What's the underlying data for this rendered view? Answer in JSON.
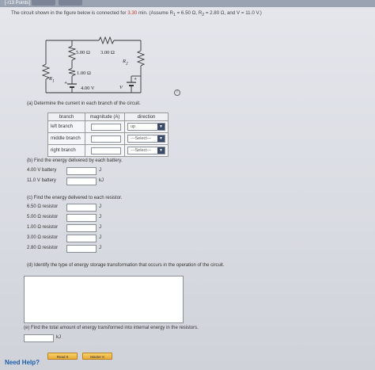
{
  "header": {
    "points_label": "[-/13 Points]"
  },
  "prompt": {
    "text_before": "The circuit shown in the figure below is connected for ",
    "time": "3.30",
    "text_mid": " min. (Assume R",
    "r1_sub": "1",
    "r1_eq": " = 6.50 Ω, R",
    "r2_sub": "2",
    "r2_eq": " = 2.80 Ω, and V = 11.0 V.)"
  },
  "circuit": {
    "r_top_left": "5.00 Ω",
    "r_top_right": "3.00 Ω",
    "r_mid": "1.00 Ω",
    "battery_left": "4.00 V",
    "r1_label": "R",
    "r1_sub": "1",
    "r2_label": "R",
    "r2_sub": "2",
    "v_label": "V"
  },
  "part_a": {
    "question": "(a) Determine the current in each branch of the circuit.",
    "headers": [
      "branch",
      "magnitude (A)",
      "direction"
    ],
    "rows": [
      {
        "branch": "left branch",
        "direction": "up"
      },
      {
        "branch": "middle branch",
        "direction": "---Select---"
      },
      {
        "branch": "right branch",
        "direction": "---Select---"
      }
    ]
  },
  "part_b": {
    "question": "(b) Find the energy delivered by each battery.",
    "rows": [
      {
        "label": "4.00 V battery",
        "unit": "J"
      },
      {
        "label": "11.0 V battery",
        "unit": "kJ"
      }
    ]
  },
  "part_c": {
    "question": "(c) Find the energy delivered to each resistor.",
    "rows": [
      {
        "label": "6.50 Ω resistor",
        "unit": "J"
      },
      {
        "label": "5.00 Ω resistor",
        "unit": "J"
      },
      {
        "label": "1.00 Ω resistor",
        "unit": "J"
      },
      {
        "label": "3.00 Ω resistor",
        "unit": "J"
      },
      {
        "label": "2.80 Ω resistor",
        "unit": "J"
      }
    ]
  },
  "part_d": {
    "question": "(d) Identify the type of energy storage transformation that occurs in the operation of the circuit."
  },
  "part_e": {
    "question": "(e) Find the total amount of energy transformed into internal energy in the resistors.",
    "unit": "kJ"
  },
  "help": {
    "label": "Need Help?",
    "read_button": "Read It",
    "master_button": "Master It"
  }
}
